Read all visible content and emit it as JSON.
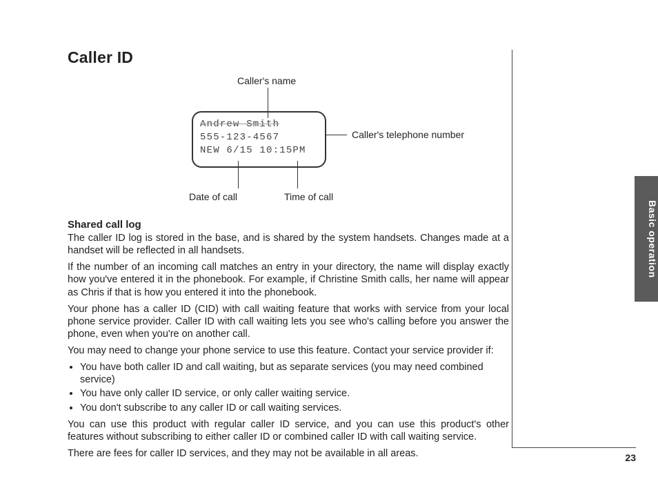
{
  "page": {
    "title": "Caller ID",
    "side_tab": "Basic operation",
    "page_number": "23"
  },
  "figure": {
    "lcd_line1": "Andrew Smith",
    "lcd_line2": "555-123-4567",
    "lcd_line3": "NEW 6/15 10:15PM",
    "label_caller_name": "Caller's name",
    "label_caller_number": "Caller's telephone number",
    "label_date": "Date of call",
    "label_time": "Time of call"
  },
  "section": {
    "heading": "Shared call log",
    "p1": "The caller ID log is stored in the base, and is shared by the system handsets. Changes made at a handset will be reflected in all handsets.",
    "p2": "If the number of an incoming call matches an entry in your directory, the name will display exactly how you've entered it in the phonebook. For example, if Christine Smith calls, her name will appear as Chris if that is how you entered it into the phonebook.",
    "p3": "Your phone has a caller ID (CID) with call waiting feature that works with service from your local phone service provider. Caller ID with call waiting lets you see who's calling before you answer the phone, even when you're on another call.",
    "p4": "You may need to change your phone service to use this feature. Contact your service provider if:",
    "bullets": [
      "You have both caller ID and call waiting, but as separate services (you may need combined service)",
      "You have only caller ID service, or only caller waiting service.",
      "You don't subscribe to any caller ID or call waiting services."
    ],
    "p5": "You can use this product with regular caller ID service, and you can use this product's other features without subscribing to either caller ID or combined caller ID with call waiting service.",
    "p6": "There are fees for caller ID services, and they may not be available in all areas."
  }
}
